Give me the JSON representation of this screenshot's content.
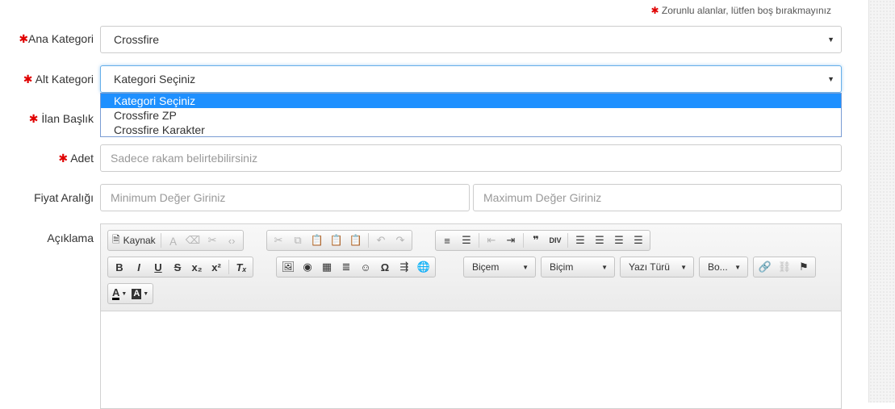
{
  "required_note": "Zorunlu alanlar, lütfen boş bırakmayınız",
  "fields": {
    "ana_kategori": {
      "label": "Ana Kategori",
      "value": "Crossfire"
    },
    "alt_kategori": {
      "label": "Alt Kategori",
      "value": "Kategori Seçiniz",
      "options": [
        "Kategori Seçiniz",
        "Crossfire ZP",
        "Crossfire Karakter"
      ]
    },
    "ilan_baslik": {
      "label": "İlan Başlık"
    },
    "adet": {
      "label": "Adet",
      "placeholder": "Sadece rakam belirtebilirsiniz"
    },
    "fiyat_araligi": {
      "label": "Fiyat Aralığı",
      "min_placeholder": "Minimum Değer Giriniz",
      "max_placeholder": "Maximum Değer Giriniz"
    },
    "aciklama": {
      "label": "Açıklama"
    }
  },
  "editor": {
    "source_label": "Kaynak",
    "combos": {
      "format": "Biçem",
      "style": "Biçim",
      "font": "Yazı Türü",
      "size": "Bo..."
    },
    "icons": {
      "row1": [
        "source-icon",
        "templates-icon",
        "paste-text-icon",
        "paste-word-icon",
        "code-icon",
        "cut-icon",
        "copy-icon",
        "paste-icon",
        "paste-plain-icon",
        "paste-from-word-icon",
        "undo-icon",
        "redo-icon",
        "numbered-list-icon",
        "bulleted-list-icon",
        "outdent-icon",
        "indent-icon",
        "blockquote-icon",
        "div-icon",
        "align-left-icon",
        "align-center-icon",
        "align-right-icon",
        "justify-icon"
      ],
      "row2": [
        "bold-icon",
        "italic-icon",
        "underline-icon",
        "strike-icon",
        "subscript-icon",
        "superscript-icon",
        "remove-format-icon",
        "image-icon",
        "flash-icon",
        "table-icon",
        "horizontal-rule-icon",
        "smiley-icon",
        "special-char-icon",
        "page-break-icon",
        "iframe-icon",
        "link-icon",
        "unlink-icon",
        "anchor-icon"
      ],
      "row3": [
        "text-color-icon",
        "background-color-icon"
      ]
    }
  }
}
